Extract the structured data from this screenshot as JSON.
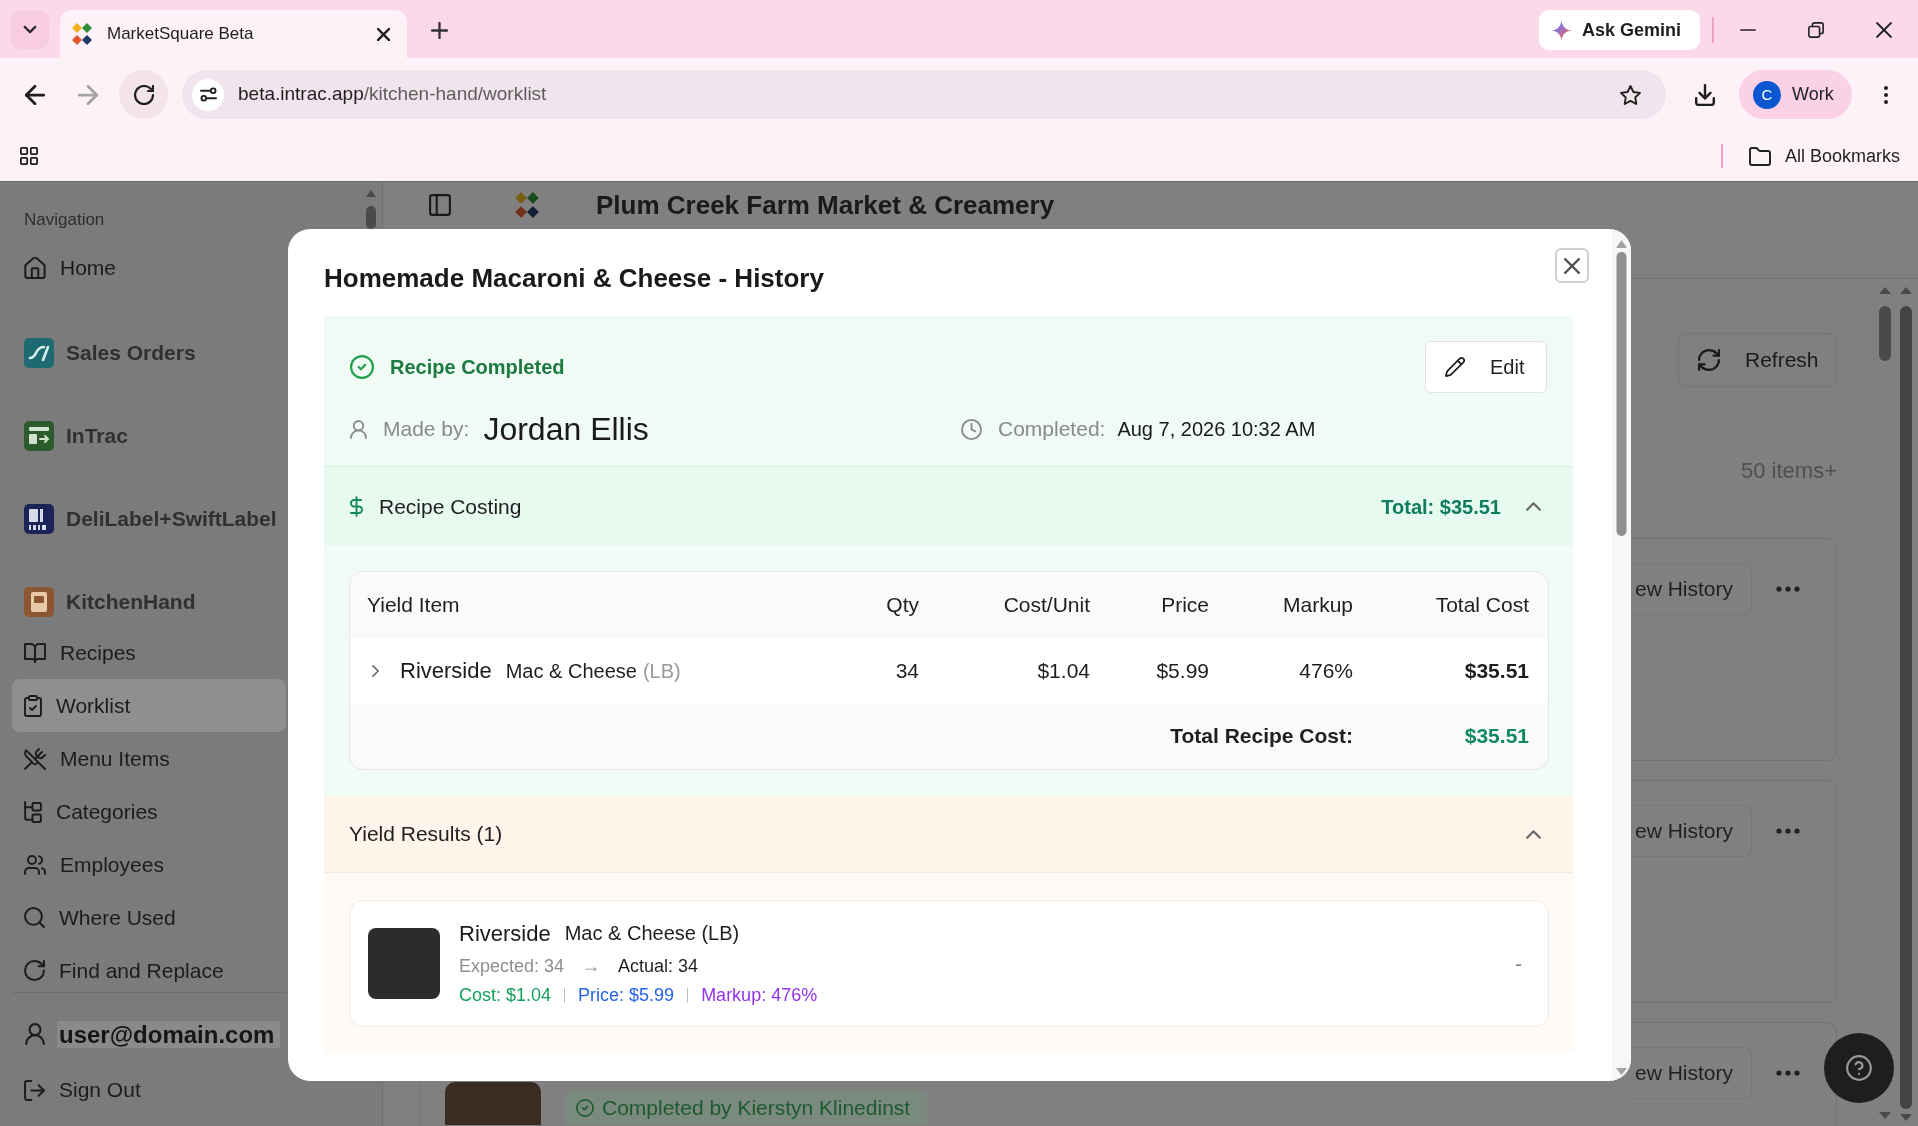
{
  "browser": {
    "tab_title": "MarketSquare Beta",
    "assistant_button": "Ask Gemini",
    "address": {
      "domain": "beta.intrac.app",
      "path": "/kitchen-hand/worklist"
    },
    "profile": {
      "initial": "C",
      "label": "Work"
    },
    "bookmarks_button": "All Bookmarks"
  },
  "sidebar": {
    "heading": "Navigation",
    "items": [
      {
        "label": "Home",
        "kind": "link",
        "selected": false
      },
      {
        "label": "Sales Orders",
        "kind": "app",
        "selected": false
      },
      {
        "label": "InTrac",
        "kind": "app",
        "selected": false
      },
      {
        "label": "DeliLabel+SwiftLabel",
        "kind": "app",
        "selected": false
      },
      {
        "label": "KitchenHand",
        "kind": "app",
        "selected": false
      },
      {
        "label": "Recipes",
        "kind": "link",
        "selected": false
      },
      {
        "label": "Worklist",
        "kind": "link",
        "selected": true
      },
      {
        "label": "Menu Items",
        "kind": "link",
        "selected": false
      },
      {
        "label": "Categories",
        "kind": "link",
        "selected": false
      },
      {
        "label": "Employees",
        "kind": "link",
        "selected": false
      },
      {
        "label": "Where Used",
        "kind": "link",
        "selected": false
      },
      {
        "label": "Find and Replace",
        "kind": "link",
        "selected": false
      }
    ],
    "user": "user@domain.com",
    "sign_out": "Sign Out"
  },
  "page": {
    "title": "Plum Creek Farm Market & Creamery",
    "refresh_button": "Refresh",
    "count": "50 items+",
    "cards": [
      {
        "button": "ew History"
      },
      {
        "button": "ew History"
      },
      {
        "button": "ew History",
        "status": "Completed by Kierstyn Klinedinst"
      }
    ]
  },
  "modal": {
    "title": "Homemade Macaroni & Cheese - History",
    "status": "Recipe Completed",
    "edit_button": "Edit",
    "made_by": {
      "label": "Made by:",
      "value": "Jordan Ellis"
    },
    "completed": {
      "label": "Completed:",
      "value": "Aug 7, 2026 10:32 AM"
    },
    "costing": {
      "title": "Recipe Costing",
      "total": "Total: $35.51",
      "expanded": true,
      "columns": [
        "Yield Item",
        "Qty",
        "Cost/Unit",
        "Price",
        "Markup",
        "Total Cost"
      ],
      "rows": [
        {
          "brand": "Riverside",
          "name": "Mac & Cheese",
          "unit": "(LB)",
          "qty": "34",
          "cost_unit": "$1.04",
          "price": "$5.99",
          "markup": "476%",
          "total_cost": "$35.51",
          "expanded": false
        }
      ],
      "footer": {
        "label": "Total Recipe Cost:",
        "value": "$35.51"
      }
    },
    "yield_results": {
      "title": "Yield Results (1)",
      "expanded": true,
      "items": [
        {
          "brand": "Riverside",
          "name": "Mac & Cheese (LB)",
          "expected": "Expected: 34",
          "arrow": "→",
          "actual": "Actual: 34",
          "cost": "Cost: $1.04",
          "price": "Price: $5.99",
          "markup": "Markup: 476%",
          "note": "-"
        }
      ]
    }
  }
}
